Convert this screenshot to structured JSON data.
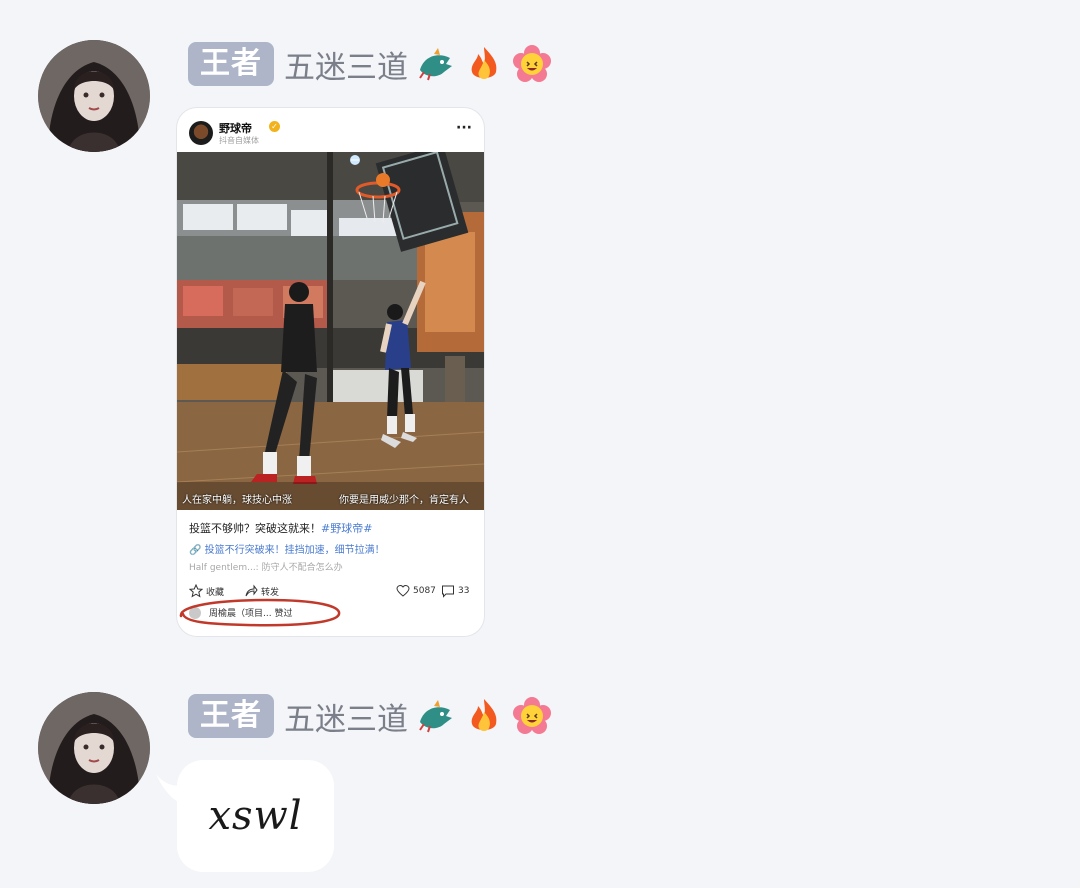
{
  "messages": [
    {
      "sender": {
        "rank": "王者",
        "nickname": "五迷三道",
        "emojis": [
          "dragon-emoji",
          "fire-emoji",
          "smiling-flower-emoji"
        ]
      },
      "type": "shared_post",
      "post": {
        "author": "野球帝",
        "author_subtitle": "抖音自媒体",
        "more": "···",
        "video_caption_left": "人在家中躺，球技心中涨",
        "video_caption_right": "你要是用威少那个，肯定有人",
        "title": "投篮不够帅？突破这就来！",
        "hashtag": "#野球帝#",
        "link": "🔗 投篮不行突破来！挂挡加速，细节拉满！",
        "comment_preview": "Half gentlem...: 防守人不配合怎么办",
        "fav_label": "收藏",
        "share_label": "转发",
        "likes": "5087",
        "comments": "33",
        "liked_by": "周榆晨（项目... 赞过"
      }
    },
    {
      "sender": {
        "rank": "王者",
        "nickname": "五迷三道",
        "emojis": [
          "dragon-emoji",
          "fire-emoji",
          "smiling-flower-emoji"
        ]
      },
      "type": "text",
      "text": "xswl"
    }
  ],
  "colors": {
    "background": "#f4f5f9",
    "badge": "#aeb5c9",
    "nickname": "#7b7f8a",
    "link": "#4a7bd0",
    "annotation": "#c0392b"
  }
}
